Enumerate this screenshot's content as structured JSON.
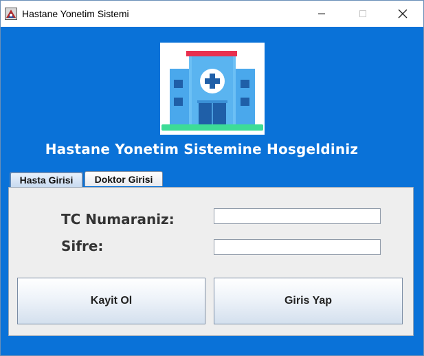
{
  "window": {
    "title": "Hastane Yonetim Sistemi",
    "icons": {
      "app": "app-icon",
      "minimize": "minimize-icon",
      "maximize": "maximize-icon",
      "close": "close-icon"
    }
  },
  "logo": {
    "icon": "hospital-icon"
  },
  "welcome": "Hastane Yonetim Sistemine Hosgeldiniz",
  "tabs": [
    {
      "label": "Hasta Girisi",
      "selected": true
    },
    {
      "label": "Doktor Girisi",
      "selected": false
    }
  ],
  "form": {
    "tc_label": "TC Numaraniz:",
    "tc_value": "",
    "password_label": "Sifre:",
    "password_value": ""
  },
  "buttons": {
    "register": "Kayit Ol",
    "login": "Giris Yap"
  },
  "colors": {
    "background": "#0a72d8",
    "panel": "#eeeeee",
    "logo_roof": "#e8304f",
    "logo_ground": "#3ddc97",
    "logo_building": "#5ab4f0"
  }
}
